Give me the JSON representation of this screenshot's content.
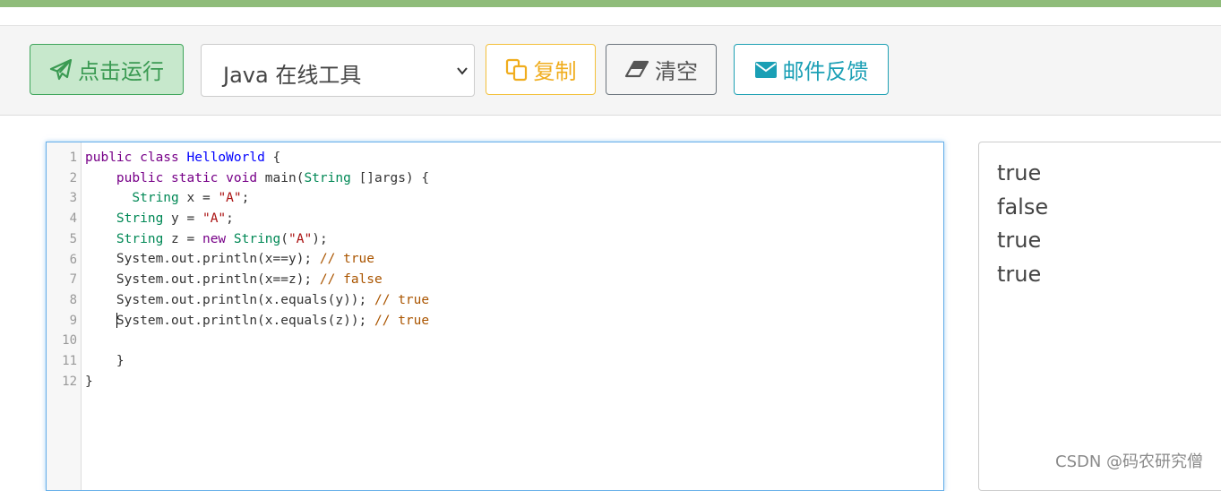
{
  "toolbar": {
    "run_label": "点击运行",
    "language": "Java 在线工具",
    "copy_label": "复制",
    "clear_label": "清空",
    "mail_label": "邮件反馈"
  },
  "editor": {
    "line_numbers": [
      "1",
      "2",
      "3",
      "4",
      "5",
      "6",
      "7",
      "8",
      "9",
      "10",
      "11",
      "12"
    ],
    "lines": [
      [
        {
          "c": "kw",
          "t": "public class "
        },
        {
          "c": "def",
          "t": "HelloWorld"
        },
        {
          "c": "",
          "t": " {"
        }
      ],
      [
        {
          "c": "",
          "t": "    "
        },
        {
          "c": "kw",
          "t": "public static void "
        },
        {
          "c": "",
          "t": "main("
        },
        {
          "c": "ty",
          "t": "String"
        },
        {
          "c": "",
          "t": " []args) {"
        }
      ],
      [
        {
          "c": "",
          "t": "      "
        },
        {
          "c": "ty",
          "t": "String"
        },
        {
          "c": "",
          "t": " x = "
        },
        {
          "c": "str",
          "t": "\"A\""
        },
        {
          "c": "",
          "t": ";"
        }
      ],
      [
        {
          "c": "",
          "t": "    "
        },
        {
          "c": "ty",
          "t": "String"
        },
        {
          "c": "",
          "t": " y = "
        },
        {
          "c": "str",
          "t": "\"A\""
        },
        {
          "c": "",
          "t": ";"
        }
      ],
      [
        {
          "c": "",
          "t": "    "
        },
        {
          "c": "ty",
          "t": "String"
        },
        {
          "c": "",
          "t": " z = "
        },
        {
          "c": "kw",
          "t": "new "
        },
        {
          "c": "ty",
          "t": "String"
        },
        {
          "c": "",
          "t": "("
        },
        {
          "c": "str",
          "t": "\"A\""
        },
        {
          "c": "",
          "t": ");"
        }
      ],
      [
        {
          "c": "",
          "t": "    System.out.println(x==y); "
        },
        {
          "c": "cm",
          "t": "// true"
        }
      ],
      [
        {
          "c": "",
          "t": "    System.out.println(x==z); "
        },
        {
          "c": "cm",
          "t": "// false"
        }
      ],
      [
        {
          "c": "",
          "t": "    System.out.println(x.equals(y)); "
        },
        {
          "c": "cm",
          "t": "// true"
        }
      ],
      [
        {
          "c": "",
          "t": "    "
        },
        {
          "c": "cursor",
          "t": ""
        },
        {
          "c": "",
          "t": "System.out.println(x.equals(z)); "
        },
        {
          "c": "cm",
          "t": "// true"
        }
      ],
      [
        {
          "c": "",
          "t": ""
        }
      ],
      [
        {
          "c": "",
          "t": "    }"
        }
      ],
      [
        {
          "c": "",
          "t": "}"
        }
      ]
    ]
  },
  "output": {
    "lines": [
      "true",
      "false",
      "true",
      "true"
    ]
  },
  "watermark": "CSDN @码农研究僧",
  "colors": {
    "run_green": "#3a9a52",
    "copy_yellow": "#f0ad1e",
    "mail_teal": "#1a9fb5",
    "editor_focus": "#66afe9"
  }
}
